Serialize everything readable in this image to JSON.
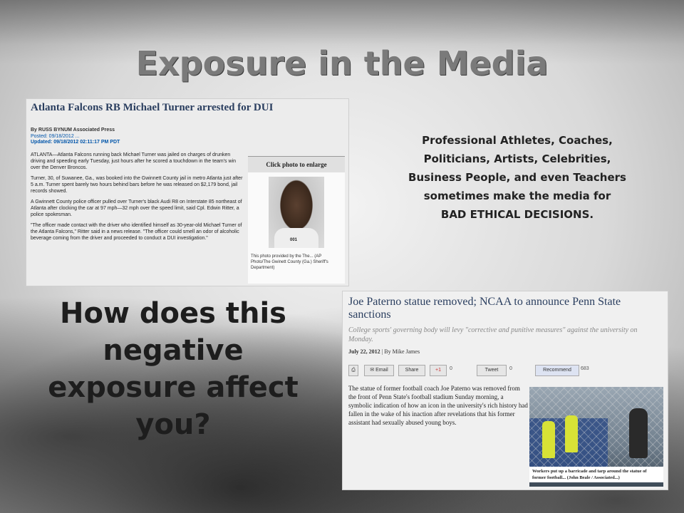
{
  "slide": {
    "title": "Exposure in the Media",
    "description": [
      "Professional Athletes, Coaches,",
      "Politicians,  Artists, Celebrities,",
      "Business People, and even Teachers",
      "sometimes make the media for",
      "BAD ETHICAL DECISIONS."
    ],
    "question": "How does this negative exposure affect you?"
  },
  "article1": {
    "headline": "Atlanta Falcons RB Michael Turner arrested for DUI",
    "byline": "By RUSS BYNUM Associated Press",
    "posted": "Posted: 09/18/2012 ...",
    "updated": "Updated:  09/18/2012 02:11:17 PM PDT",
    "paragraphs": [
      "ATLANTA—Atlanta Falcons running back Michael Turner was jailed on charges of drunken driving and speeding early Tuesday, just hours after he scored a touchdown in the team's win over the Denver Broncos.",
      "Turner, 30, of Suwanee, Ga., was booked into the Gwinnett County jail in metro Atlanta just after 5 a.m. Turner spent barely two hours behind bars before he was released on $2,179 bond, jail records showed.",
      "A Gwinnett County police officer pulled over Turner's black Audi R8 on Interstate 85 northeast of Atlanta after clocking the car at 97 mph—32 mph over the speed limit, said Cpl. Edwin Ritter, a police spokesman.",
      "\"The officer made contact with the driver who identified himself as 30-year-old Michael Turner of the Atlanta Falcons,\" Ritter said in a news release. \"The officer could smell an odor of alcoholic beverage coming from the driver and proceeded to conduct a DUI investigation.\""
    ],
    "enlarge_label": "Click photo to enlarge",
    "mug_tag": "001",
    "photo_caption": "This photo provided by the The... (AP Photo/The Gwinett County (Ga.) Sheriff's Department)"
  },
  "article2": {
    "headline": "Joe Paterno statue removed; NCAA to announce Penn State sanctions",
    "deck": "College sports' governing body will levy \"corrective and punitive measures\" against the university on Monday.",
    "date": "July 22, 2012",
    "author": "By Mike James",
    "share": {
      "email": "Email",
      "share": "Share",
      "plus": "+1",
      "plus_count": "0",
      "tweet": "Tweet",
      "tweet_count": "0",
      "recommend": "Recommend",
      "recommend_count": "683"
    },
    "body": "The statue of former football coach Joe Paterno was removed from the front of Penn State's football stadium Sunday morning, a symbolic indication of how an icon in the university's rich history had fallen in the wake of his inaction after revelations that his former assistant had sexually abused young boys.",
    "photo_caption": "Workers put up a barricade and tarp around the statue of former football... (John Beale / Associated...)"
  }
}
